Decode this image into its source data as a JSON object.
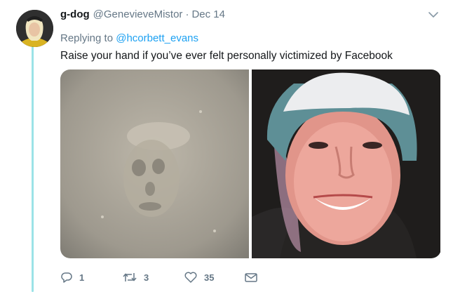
{
  "tweet": {
    "display_name": "g-dog",
    "handle": "@GenevieveMistor",
    "separator": "·",
    "date": "Dec 14",
    "reply_prefix": "Replying to",
    "reply_to": "@hcorbett_evans",
    "text": "Raise your hand if you’ve ever felt personally victimized by Facebook"
  },
  "actions": {
    "replies": "1",
    "retweets": "3",
    "likes": "35"
  },
  "icons": {
    "reply": "reply-icon",
    "retweet": "retweet-icon",
    "like": "heart-icon",
    "message": "envelope-icon",
    "menu": "chevron-down-icon"
  },
  "colors": {
    "thread_line": "#9be3e7",
    "mention": "#1da1f2",
    "muted": "#657786"
  }
}
